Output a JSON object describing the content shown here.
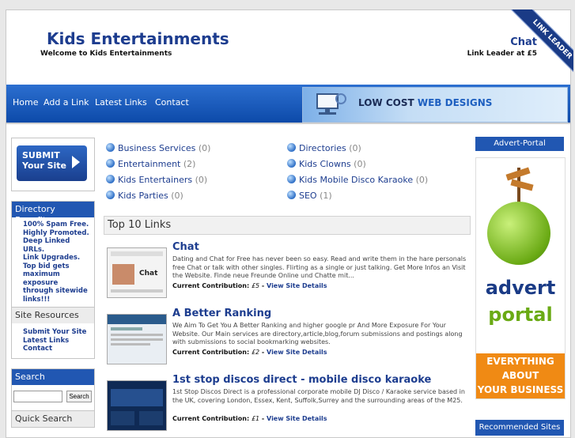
{
  "header": {
    "site_title": "Kids Entertainments",
    "subtitle": "Welcome to Kids Entertainments",
    "right_title": "Chat",
    "right_sub": "Link Leader at £5",
    "ribbon": "LINK LEADER"
  },
  "nav": {
    "items": [
      "Home",
      "Add a Link",
      "Latest Links",
      "Contact"
    ],
    "banner_text_a": "LOW COST",
    "banner_text_b": "WEB DESIGNS"
  },
  "left": {
    "submit_line1": "SUBMIT",
    "submit_line2": "Your Site",
    "benefits_title": "Directory Benefits",
    "benefits": [
      "100% Spam Free.",
      "Highly Promoted.",
      "Deep Linked URLs.",
      "Link Upgrades.",
      "Top bid gets",
      "maximum exposure",
      "through sitewide",
      "links!!!"
    ],
    "resources_title": "Site Resources",
    "resources": [
      "Submit Your Site",
      "Latest Links",
      "Contact"
    ],
    "search_title": "Search",
    "search_button": "Search",
    "quick_search_title": "Quick Search"
  },
  "categories": [
    {
      "name": "Business Services",
      "count": "(0)"
    },
    {
      "name": "Entertainment",
      "count": "(2)"
    },
    {
      "name": "Kids Entertainers",
      "count": "(0)"
    },
    {
      "name": "Kids Parties",
      "count": "(0)"
    },
    {
      "name": "Directories",
      "count": "(0)"
    },
    {
      "name": "Kids Clowns",
      "count": "(0)"
    },
    {
      "name": "Kids Mobile Disco Karaoke",
      "count": "(0)"
    },
    {
      "name": "SEO",
      "count": "(1)"
    }
  ],
  "top10": {
    "heading": "Top 10 Links",
    "contrib_label": "Current Contribution:",
    "details_label": "View Site Details",
    "entries": [
      {
        "title": "Chat",
        "desc": "Dating and Chat for Free has never been so easy. Read and write them in the hare personals free Chat or talk with other singles. Flirting as a single or just talking. Get More Infos an Visit the Website. Finde neue Freunde Online und Chatte mit...",
        "amount": "£5"
      },
      {
        "title": "A Better Ranking",
        "desc": "We Aim To Get You A Better Ranking and higher google pr And More Exposure For Your Website. Our Main services are directory,article,blog,forum submissions and postings along with submissions to social bookmarking websites.",
        "amount": "£2"
      },
      {
        "title": "1st stop discos direct - mobile disco karaoke",
        "desc": "1st Stop Discos Direct is a professional corporate mobile DJ Disco / Karaoke service based in the UK, covering London, Essex, Kent, Suffolk,Surrey and the surrounding areas of the M25.",
        "amount": "£1"
      }
    ]
  },
  "right": {
    "advert_title": "Advert-Portal",
    "advert_word1": "advert",
    "advert_word2": "portal",
    "advert_tag1": "EVERYTHING",
    "advert_tag2": "ABOUT",
    "advert_tag3": "YOUR BUSINESS",
    "recommended_title": "Recommended Sites"
  },
  "colors": {
    "brand_blue": "#1d3d8f",
    "nav_blue": "#2157b2",
    "accent_orange": "#f08a14"
  }
}
